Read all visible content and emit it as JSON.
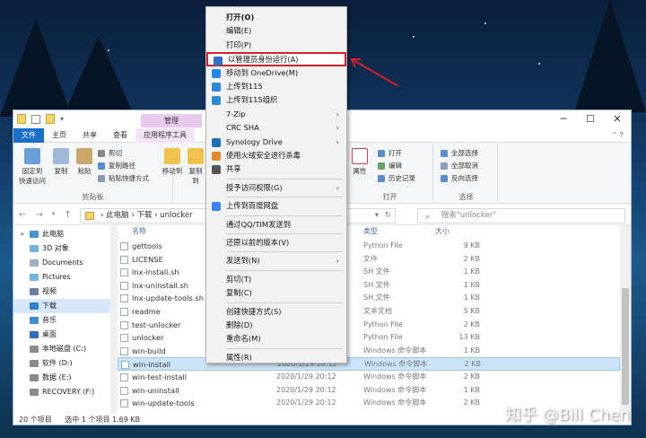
{
  "explorer": {
    "title_tab": "管理",
    "tabs": [
      "文件",
      "主页",
      "共享",
      "查看",
      "应用程序工具"
    ],
    "ribbon": {
      "pin_label": "固定到\n快速访问",
      "copy_label": "复制",
      "paste_label": "粘贴",
      "cut_label": "剪切",
      "copy_path_label": "复制路径",
      "paste_shortcut_label": "粘贴快捷方式",
      "clipboard_group": "剪贴板",
      "move_to_label": "移动到",
      "copy_to_label": "复制到",
      "organize_group": "组",
      "properties_label": "属性",
      "open_label": "打开",
      "edit_label": "编辑",
      "history_label": "历史记录",
      "open_group": "打开",
      "select_all_label": "全部选择",
      "select_none_label": "全部取消",
      "invert_select_label": "反向选择",
      "select_group": "选择"
    },
    "address": {
      "path": [
        "此电脑",
        "下载",
        "unlocker"
      ],
      "search_placeholder": "搜索\"unlocker\""
    },
    "sidebar": [
      {
        "label": "此电脑",
        "expanded": true,
        "icon": "pc"
      },
      {
        "label": "3D 对象",
        "icon": "3d"
      },
      {
        "label": "Documents",
        "icon": "doc"
      },
      {
        "label": "Pictures",
        "icon": "pic"
      },
      {
        "label": "视频",
        "icon": "video"
      },
      {
        "label": "下载",
        "icon": "download",
        "selected": true
      },
      {
        "label": "音乐",
        "icon": "music"
      },
      {
        "label": "桌面",
        "icon": "desktop"
      },
      {
        "label": "本地磁盘 (C:)",
        "icon": "drive"
      },
      {
        "label": "软件 (D:)",
        "icon": "drive"
      },
      {
        "label": "数据 (E:)",
        "icon": "drive"
      },
      {
        "label": "RECOVERY (F:)",
        "icon": "drive"
      }
    ],
    "columns": {
      "name": "名称",
      "type": "类型",
      "size": "大小"
    },
    "files": [
      {
        "name": "gettools",
        "date": "",
        "type": "Python File",
        "size": "9 KB"
      },
      {
        "name": "LICENSE",
        "date": "",
        "type": "文件",
        "size": "2 KB"
      },
      {
        "name": "lnx-install.sh",
        "date": "",
        "type": "SH 文件",
        "size": "1 KB"
      },
      {
        "name": "lnx-uninstall.sh",
        "date": "",
        "type": "SH 文件",
        "size": "1 KB"
      },
      {
        "name": "lnx-update-tools.sh",
        "date": "",
        "type": "SH 文件",
        "size": "1 KB"
      },
      {
        "name": "readme",
        "date": "",
        "type": "文本文档",
        "size": "5 KB"
      },
      {
        "name": "test-unlocker",
        "date": "",
        "type": "Python File",
        "size": "2 KB"
      },
      {
        "name": "unlocker",
        "date": "",
        "type": "Python File",
        "size": "13 KB"
      },
      {
        "name": "win-build",
        "date": "",
        "type": "Windows 命令脚本",
        "size": "1 KB"
      },
      {
        "name": "win-install",
        "date": "2020/1/29 20:12",
        "type": "Windows 命令脚本",
        "size": "2 KB",
        "selected": true
      },
      {
        "name": "win-test-install",
        "date": "2020/1/29 20:12",
        "type": "Windows 命令脚本",
        "size": "2 KB"
      },
      {
        "name": "win-uninstall",
        "date": "2020/1/29 20:12",
        "type": "Windows 命令脚本",
        "size": "1 KB"
      },
      {
        "name": "win-update-tools",
        "date": "2020/1/29 20:12",
        "type": "Windows 命令脚本",
        "size": "2 KB"
      }
    ],
    "status": {
      "count": "20 个项目",
      "selected": "选中 1 个项目 1.69 KB"
    }
  },
  "context_menu": [
    {
      "label": "打开(O)",
      "bold": true
    },
    {
      "label": "编辑(E)"
    },
    {
      "label": "打印(P)"
    },
    {
      "label": "以管理员身份运行(A)",
      "icon": "shield",
      "highlighted": true
    },
    {
      "label": "移动到 OneDrive(M)",
      "icon": "onedrive"
    },
    {
      "label": "上传到115",
      "icon": "115"
    },
    {
      "label": "上传到115组织",
      "icon": "115"
    },
    {
      "label": "7-Zip",
      "submenu": true
    },
    {
      "label": "CRC SHA",
      "submenu": true
    },
    {
      "label": "Synology Drive",
      "icon": "synology",
      "submenu": true
    },
    {
      "label": "使用火绒安全进行杀毒",
      "icon": "huorong"
    },
    {
      "label": "共享",
      "icon": "share"
    },
    {
      "separator": true
    },
    {
      "label": "授予访问权限(G)",
      "submenu": true
    },
    {
      "separator": true
    },
    {
      "label": "上传到百度网盘",
      "icon": "baidu"
    },
    {
      "separator": true
    },
    {
      "label": "通过QQ/TIM发送到"
    },
    {
      "separator": true
    },
    {
      "label": "还原以前的版本(V)"
    },
    {
      "separator": true
    },
    {
      "label": "发送到(N)",
      "submenu": true
    },
    {
      "separator": true
    },
    {
      "label": "剪切(T)"
    },
    {
      "label": "复制(C)"
    },
    {
      "separator": true
    },
    {
      "label": "创建快捷方式(S)"
    },
    {
      "label": "删除(D)"
    },
    {
      "label": "重命名(M)"
    },
    {
      "separator": true
    },
    {
      "label": "属性(R)"
    }
  ],
  "watermark": "知乎 @Bill Chen",
  "colors": {
    "highlight": "#d6202a",
    "file_tab": "#1a6fc7",
    "manage_tab": "#e7c9ec",
    "selection": "#cce4f7"
  }
}
